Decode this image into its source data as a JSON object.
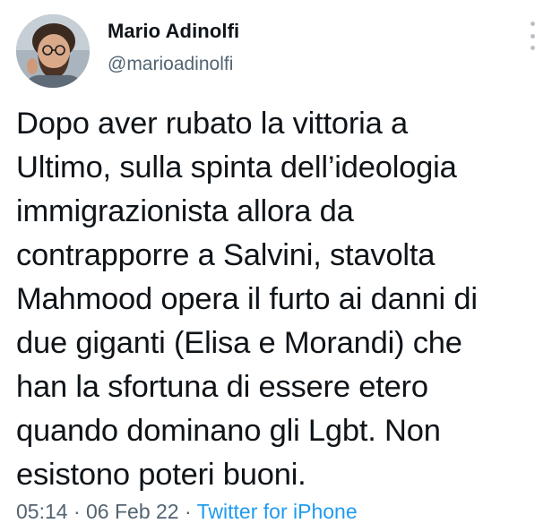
{
  "author": {
    "display_name": "Mario Adinolfi",
    "handle": "@marioadinolfi"
  },
  "tweet": {
    "text": "Dopo aver rubato la vittoria a\nUltimo, sulla spinta dell’ideologia\nimmigrazionista allora da\ncontrapporre a Salvini, stavolta\nMahmood opera il furto ai danni di\ndue giganti (Elisa e Morandi) che\nhan la sfortuna di essere etero\nquando dominano gli Lgbt. Non\nesistono poteri buoni.",
    "time": "05:14",
    "separator": "·",
    "date": "06 Feb 22",
    "source": "Twitter for iPhone"
  },
  "icons": {
    "menu": "more-vertical-icon"
  },
  "colors": {
    "text": "#0f1419",
    "secondary": "#536471",
    "link": "#1d9bf0"
  }
}
